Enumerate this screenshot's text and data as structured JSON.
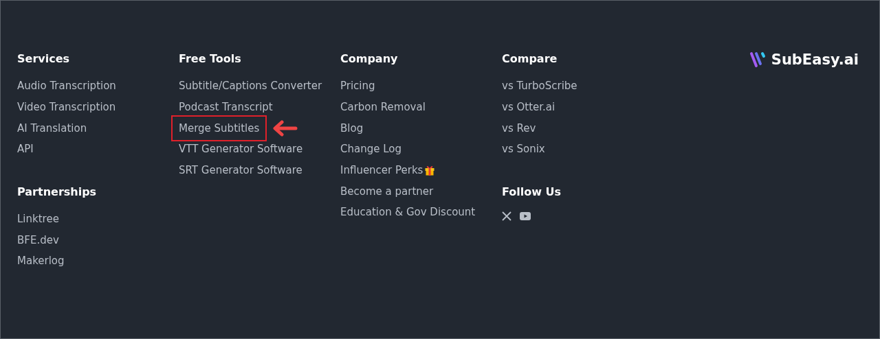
{
  "columns": [
    {
      "sections": [
        {
          "title": "Services",
          "links": [
            {
              "label": "Audio Transcription",
              "kind": "link",
              "highlighted": false
            },
            {
              "label": "Video Transcription",
              "kind": "link",
              "highlighted": false
            },
            {
              "label": "AI Translation",
              "kind": "link",
              "highlighted": false
            },
            {
              "label": "API",
              "kind": "link",
              "highlighted": false
            }
          ]
        },
        {
          "title": "Partnerships",
          "links": [
            {
              "label": "Linktree",
              "kind": "link",
              "highlighted": false
            },
            {
              "label": "BFE.dev",
              "kind": "link",
              "highlighted": false
            },
            {
              "label": "Makerlog",
              "kind": "link",
              "highlighted": false
            }
          ]
        }
      ]
    },
    {
      "sections": [
        {
          "title": "Free Tools",
          "links": [
            {
              "label": "Subtitle/Captions Converter",
              "kind": "link",
              "highlighted": false
            },
            {
              "label": "Podcast Transcript",
              "kind": "link",
              "highlighted": false
            },
            {
              "label": "Merge Subtitles",
              "kind": "link",
              "highlighted": true
            },
            {
              "label": "VTT Generator Software",
              "kind": "link",
              "highlighted": false
            },
            {
              "label": "SRT Generator Software",
              "kind": "link",
              "highlighted": false
            }
          ]
        }
      ]
    },
    {
      "sections": [
        {
          "title": "Company",
          "links": [
            {
              "label": "Pricing",
              "kind": "link",
              "highlighted": false
            },
            {
              "label": "Carbon Removal",
              "kind": "link",
              "highlighted": false
            },
            {
              "label": "Blog",
              "kind": "link",
              "highlighted": false
            },
            {
              "label": "Change Log",
              "kind": "link",
              "highlighted": false
            },
            {
              "label": "Influencer Perks",
              "kind": "gift",
              "highlighted": false
            },
            {
              "label": "Become a partner",
              "kind": "link",
              "highlighted": false
            },
            {
              "label": "Education & Gov Discount",
              "kind": "link",
              "highlighted": false
            }
          ]
        }
      ]
    },
    {
      "sections": [
        {
          "title": "Compare",
          "links": [
            {
              "label": "vs TurboScribe",
              "kind": "link",
              "highlighted": false
            },
            {
              "label": "vs Otter.ai",
              "kind": "link",
              "highlighted": false
            },
            {
              "label": "vs Rev",
              "kind": "link",
              "highlighted": false
            },
            {
              "label": "vs Sonix",
              "kind": "link",
              "highlighted": false
            }
          ]
        },
        {
          "title": "Follow Us",
          "social": true
        }
      ]
    }
  ],
  "brand": {
    "name": "SubEasy.ai"
  }
}
